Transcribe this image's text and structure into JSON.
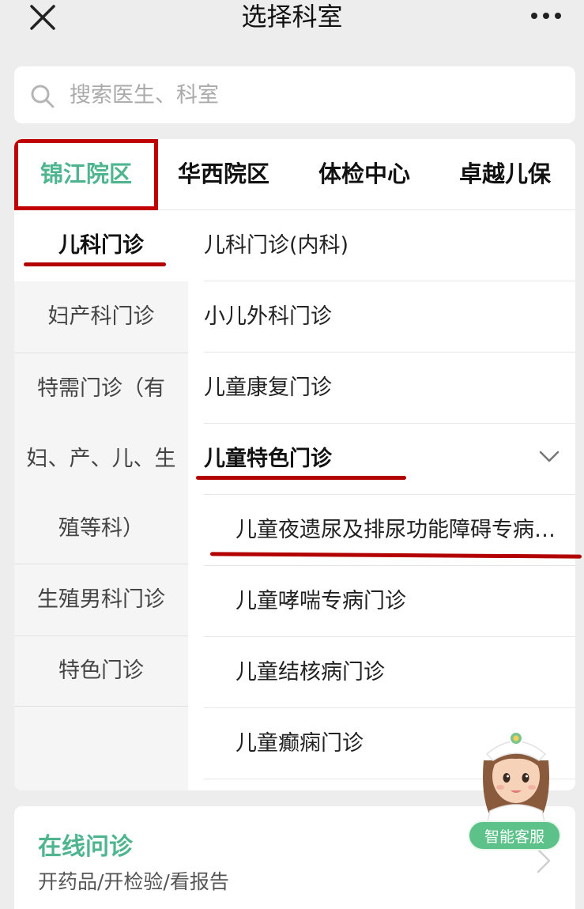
{
  "header": {
    "title": "选择科室",
    "close_icon": "close-icon",
    "more_icon": "more-icon"
  },
  "search": {
    "placeholder": "搜索医生、科室",
    "icon": "search-icon"
  },
  "tabs": [
    {
      "label": "锦江院区",
      "active": true
    },
    {
      "label": "华西院区",
      "active": false
    },
    {
      "label": "体检中心",
      "active": false
    },
    {
      "label": "卓越儿保",
      "active": false
    }
  ],
  "categories": [
    {
      "label": "儿科门诊",
      "active": true
    },
    {
      "label": "妇产科门诊",
      "active": false
    },
    {
      "lines": [
        "特需门诊（有",
        "妇、产、儿、生",
        "殖等科）"
      ],
      "active": false
    },
    {
      "label": "生殖男科门诊",
      "active": false
    },
    {
      "label": "特色门诊",
      "active": false
    }
  ],
  "departments": [
    {
      "label": "儿科门诊(内科)"
    },
    {
      "label": "小儿外科门诊"
    },
    {
      "label": "儿童康复门诊"
    },
    {
      "label": "儿童特色门诊",
      "expanded": true
    },
    {
      "label": "儿童夜遗尿及排尿功能障碍专病…"
    },
    {
      "label": "儿童哮喘专病门诊"
    },
    {
      "label": "儿童结核病门诊"
    },
    {
      "label": "儿童癫痫门诊"
    }
  ],
  "online": {
    "title": "在线问诊",
    "subtitle": "开药品/开检验/看报告"
  },
  "assistant": {
    "label": "智能客服"
  },
  "colors": {
    "accent_green": "#4eb590",
    "highlight_red": "#c00000",
    "assistant_green": "#5cc289"
  }
}
